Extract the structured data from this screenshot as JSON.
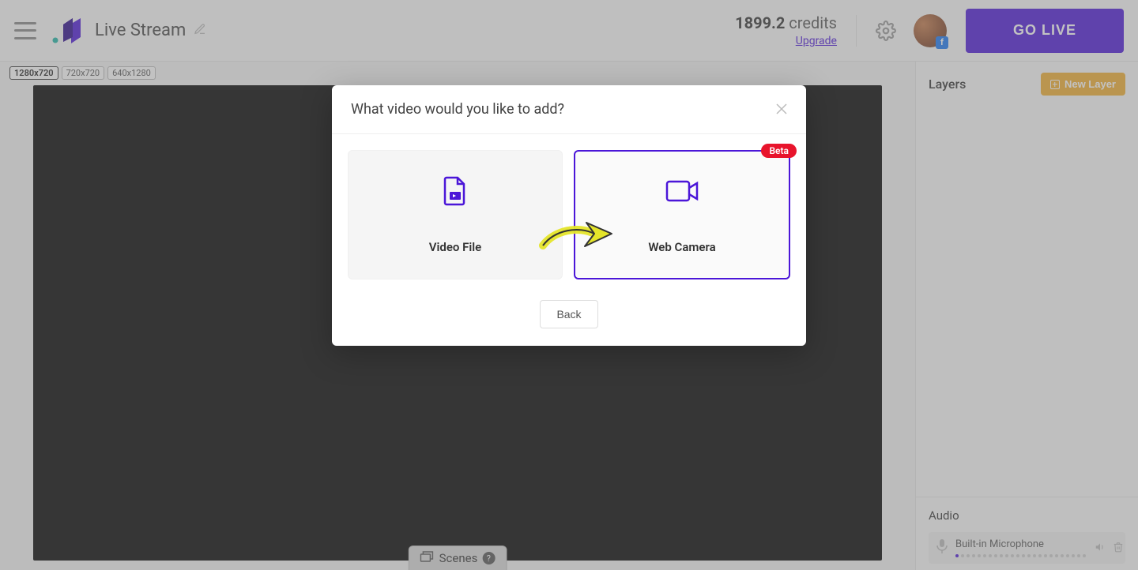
{
  "header": {
    "title": "Live Stream",
    "credits_value": "1899.2",
    "credits_label": "credits",
    "upgrade": "Upgrade",
    "go_live": "GO LIVE",
    "avatar_badge": "f"
  },
  "resolutions": {
    "r0": "1280x720",
    "r1": "720x720",
    "r2": "640x1280"
  },
  "scenes": {
    "label": "Scenes",
    "help": "?"
  },
  "sidebar": {
    "layers_title": "Layers",
    "new_layer": "New Layer",
    "audio_title": "Audio",
    "audio_item_name": "Built-in Microphone"
  },
  "modal": {
    "title": "What video would you like to add?",
    "card_video_file": "Video File",
    "card_web_camera": "Web Camera",
    "beta": "Beta",
    "back": "Back"
  }
}
